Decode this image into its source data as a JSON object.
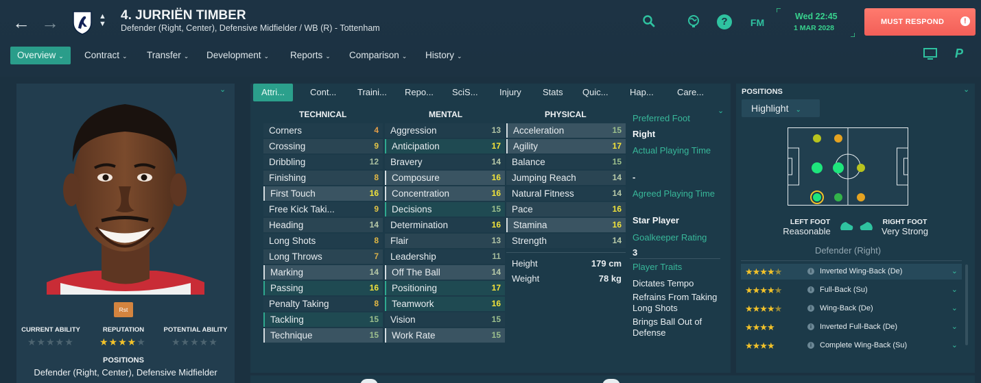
{
  "header": {
    "back_icon": "←",
    "forward_icon": "→",
    "player_title": "4. JURRIËN TIMBER",
    "subtitle": "Defender (Right, Center), Defensive Midfielder / WB (R) - Tottenham",
    "date_day": "Wed 22:45",
    "date_full": "1 MAR 2028",
    "must_respond": "MUST RESPOND",
    "fm_label": "FM"
  },
  "nav": {
    "items": [
      {
        "label": "Overview"
      },
      {
        "label": "Contract"
      },
      {
        "label": "Transfer"
      },
      {
        "label": "Development"
      },
      {
        "label": "Reports"
      },
      {
        "label": "Comparison"
      },
      {
        "label": "History"
      }
    ]
  },
  "left": {
    "rst_badge": "Rst",
    "current_ability": "CURRENT ABILITY",
    "reputation": "REPUTATION",
    "potential_ability": "POTENTIAL ABILITY",
    "reputation_stars": 4,
    "positions_label": "POSITIONS",
    "positions_text": "Defender (Right, Center), Defensive Midfielder"
  },
  "tabs": [
    {
      "label": "Attri..."
    },
    {
      "label": "Cont..."
    },
    {
      "label": "Traini..."
    },
    {
      "label": "Repo..."
    },
    {
      "label": "SciS..."
    },
    {
      "label": "Injury"
    },
    {
      "label": "Stats"
    },
    {
      "label": "Quic..."
    },
    {
      "label": "Hap..."
    },
    {
      "label": "Care..."
    }
  ],
  "attributes": {
    "technical_title": "TECHNICAL",
    "mental_title": "MENTAL",
    "physical_title": "PHYSICAL",
    "technical": [
      {
        "name": "Corners",
        "value": "4"
      },
      {
        "name": "Crossing",
        "value": "9"
      },
      {
        "name": "Dribbling",
        "value": "12"
      },
      {
        "name": "Finishing",
        "value": "8"
      },
      {
        "name": "First Touch",
        "value": "16"
      },
      {
        "name": "Free Kick Taki...",
        "value": "9"
      },
      {
        "name": "Heading",
        "value": "14"
      },
      {
        "name": "Long Shots",
        "value": "8"
      },
      {
        "name": "Long Throws",
        "value": "7"
      },
      {
        "name": "Marking",
        "value": "14"
      },
      {
        "name": "Passing",
        "value": "16"
      },
      {
        "name": "Penalty Taking",
        "value": "8"
      },
      {
        "name": "Tackling",
        "value": "15"
      },
      {
        "name": "Technique",
        "value": "15"
      }
    ],
    "mental": [
      {
        "name": "Aggression",
        "value": "13"
      },
      {
        "name": "Anticipation",
        "value": "17"
      },
      {
        "name": "Bravery",
        "value": "14"
      },
      {
        "name": "Composure",
        "value": "16"
      },
      {
        "name": "Concentration",
        "value": "16"
      },
      {
        "name": "Decisions",
        "value": "15"
      },
      {
        "name": "Determination",
        "value": "16"
      },
      {
        "name": "Flair",
        "value": "13"
      },
      {
        "name": "Leadership",
        "value": "11"
      },
      {
        "name": "Off The Ball",
        "value": "14"
      },
      {
        "name": "Positioning",
        "value": "17"
      },
      {
        "name": "Teamwork",
        "value": "16"
      },
      {
        "name": "Vision",
        "value": "15"
      },
      {
        "name": "Work Rate",
        "value": "15"
      }
    ],
    "physical": [
      {
        "name": "Acceleration",
        "value": "15"
      },
      {
        "name": "Agility",
        "value": "17"
      },
      {
        "name": "Balance",
        "value": "15"
      },
      {
        "name": "Jumping Reach",
        "value": "14"
      },
      {
        "name": "Natural Fitness",
        "value": "14"
      },
      {
        "name": "Pace",
        "value": "16"
      },
      {
        "name": "Stamina",
        "value": "16"
      },
      {
        "name": "Strength",
        "value": "14"
      }
    ],
    "height_label": "Height",
    "height_value": "179 cm",
    "weight_label": "Weight",
    "weight_value": "78 kg"
  },
  "info": {
    "preferred_foot_label": "Preferred Foot",
    "preferred_foot_value": "Right",
    "actual_playing_time_label": "Actual Playing Time",
    "actual_playing_time_value": "-",
    "agreed_playing_time_label": "Agreed Playing Time",
    "agreed_playing_time_value": "Star Player",
    "gk_rating_label": "Goalkeeper Rating",
    "gk_rating_value": "3",
    "traits_label": "Player Traits",
    "traits": [
      "Dictates Tempo",
      "Refrains From Taking Long Shots",
      "Brings Ball Out of Defense"
    ]
  },
  "positions_panel": {
    "title": "POSITIONS",
    "highlight": "Highlight",
    "left_foot_label": "LEFT FOOT",
    "left_foot_value": "Reasonable",
    "right_foot_label": "RIGHT FOOT",
    "right_foot_value": "Very Strong",
    "selected_position": "Defender (Right)",
    "roles": [
      {
        "name": "Inverted Wing-Back (De)",
        "stars": 4.5
      },
      {
        "name": "Full-Back (Su)",
        "stars": 4.5
      },
      {
        "name": "Wing-Back (De)",
        "stars": 4.5
      },
      {
        "name": "Inverted Full-Back (De)",
        "stars": 4
      },
      {
        "name": "Complete Wing-Back (Su)",
        "stars": 4
      }
    ]
  },
  "colors": {
    "accent": "#2a9d8a",
    "must_respond": "#f2655d",
    "natural": "#1ee57c",
    "accomplished": "#33b34a",
    "competent": "#b8c31e",
    "unconvincing": "#e5a321"
  }
}
